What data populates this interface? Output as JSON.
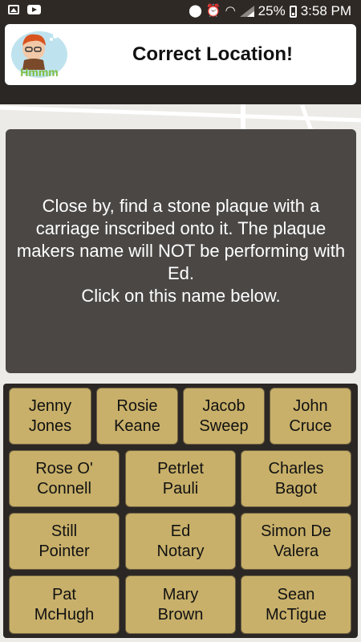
{
  "status_bar": {
    "battery": "25%",
    "time": "3:58 PM",
    "icons": [
      "image-notification-icon",
      "youtube-icon",
      "location-icon",
      "alarm-icon",
      "wifi-icon",
      "signal-icon",
      "battery-icon"
    ]
  },
  "header": {
    "logo_text": "Hmmm",
    "title": "Correct Location!"
  },
  "instructions": {
    "text": "Close by, find a stone plaque with a carriage inscribed onto it. The plaque makers name will NOT be performing with Ed.\nClick on this name below."
  },
  "choices": [
    "Jenny\nJones",
    "Rosie\nKeane",
    "Jacob\nSweep",
    "John\nCruce",
    "Rose O'\nConnell",
    "Petrlet\nPauli",
    "Charles\nBagot",
    "Still\nPointer",
    "Ed\nNotary",
    "Simon De\nValera",
    "Pat\nMcHugh",
    "Mary\nBrown",
    "Sean\nMcTigue"
  ],
  "colors": {
    "background": "#2b2724",
    "header_bg": "#ffffff",
    "instructions_bg": "#4a4745",
    "choice_bg": "#c8b06a"
  }
}
